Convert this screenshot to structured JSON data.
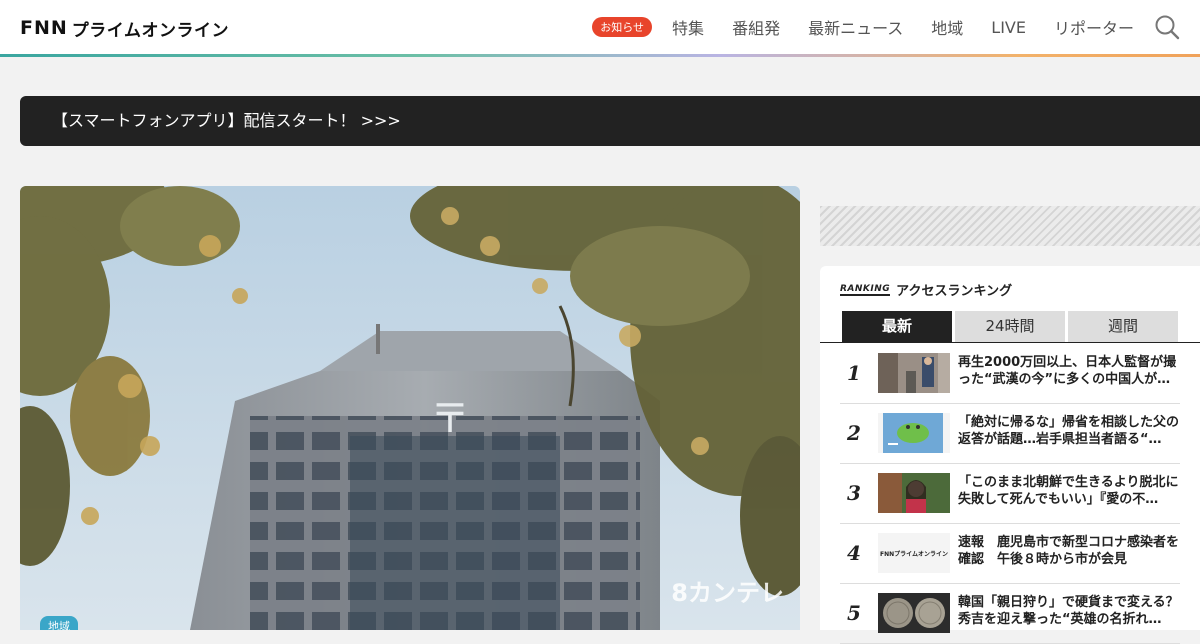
{
  "header": {
    "logo_main": "FNN",
    "logo_sub": "プライムオンライン",
    "notice_badge": "お知らせ",
    "nav": [
      "特集",
      "番組発",
      "最新ニュース",
      "地域",
      "LIVE",
      "リポーター"
    ],
    "icon": "search-icon"
  },
  "banner": {
    "text": "【スマートフォンアプリ】配信スタート！ >>>"
  },
  "hero": {
    "region_tag": "地域",
    "watermark": "8カンテレ"
  },
  "ranking": {
    "logo": "RANKING",
    "title": "アクセスランキング",
    "tabs": [
      "最新",
      "24時間",
      "週間"
    ],
    "active_tab": "最新",
    "items": [
      {
        "rank": "1",
        "title": "再生2000万回以上、日本人監督が撮った“武漢の今”に多くの中国人が…"
      },
      {
        "rank": "2",
        "title": "「絶対に帰るな」帰省を相談した父の返答が話題…岩手県担当者語る“…"
      },
      {
        "rank": "3",
        "title": "「このまま北朝鮮で生きるより脱北に失敗して死んでもいい」『愛の不…"
      },
      {
        "rank": "4",
        "title": "速報　鹿児島市で新型コロナ感染者を確認　午後８時から市が会見",
        "thumb_logo": "FNNプライムオンライン"
      },
      {
        "rank": "5",
        "title": "韓国「親日狩り」で硬貨まで変える？秀吉を迎え撃った“英雄の名折れ…"
      }
    ]
  },
  "colors": {
    "accent_red": "#e8442b",
    "banner_bg": "#222222",
    "tag_blue": "#3aa6c8"
  }
}
